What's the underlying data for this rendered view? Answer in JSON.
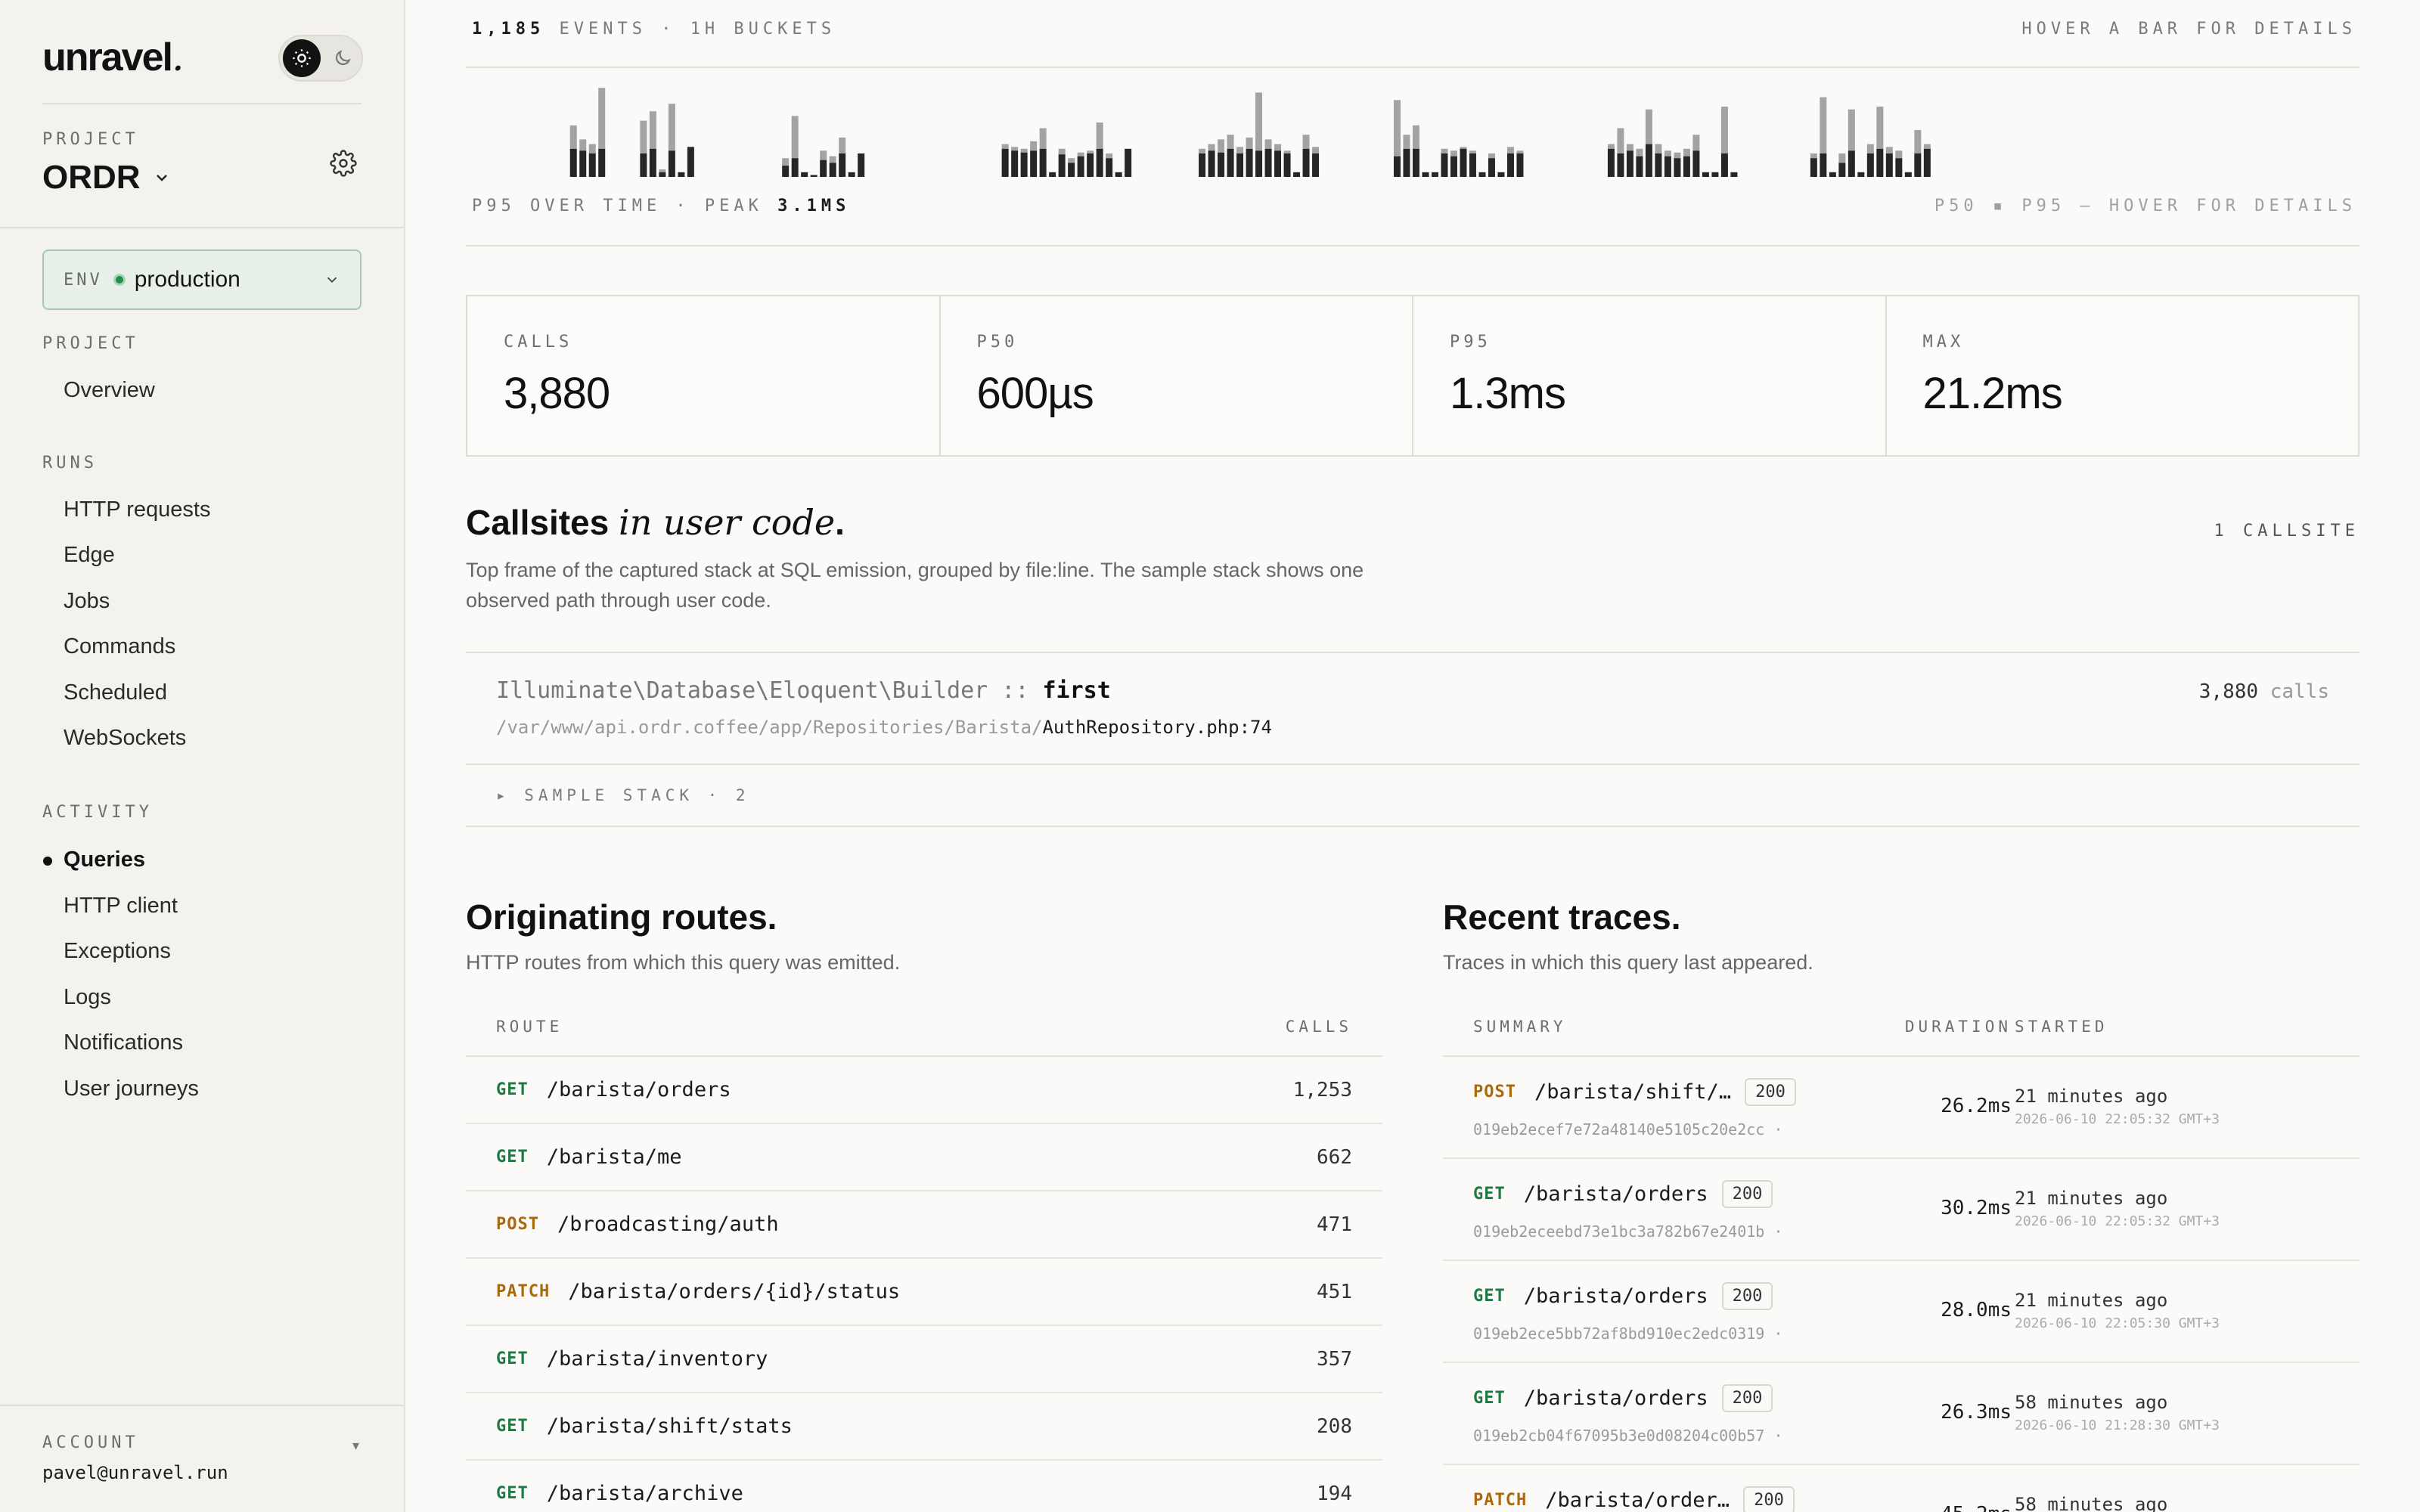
{
  "sidebar": {
    "brand": "unravel",
    "brand_suffix": ".",
    "project_label": "PROJECT",
    "project_name": "ORDR",
    "env_label": "ENV",
    "env_value": "production",
    "sections": [
      {
        "label": "PROJECT",
        "items": [
          "Overview"
        ]
      },
      {
        "label": "RUNS",
        "items": [
          "HTTP requests",
          "Edge",
          "Jobs",
          "Commands",
          "Scheduled",
          "WebSockets"
        ]
      },
      {
        "label": "ACTIVITY",
        "items": [
          "Queries",
          "HTTP client",
          "Exceptions",
          "Logs",
          "Notifications",
          "User journeys"
        ]
      }
    ],
    "active_item": "Queries",
    "account_label": "ACCOUNT",
    "account_email": "pavel@unravel.run",
    "account_toggle": "▾"
  },
  "chart": {
    "events_count": "1,185",
    "events_rest": "EVENTS · 1H BUCKETS",
    "hover_hint": "HOVER A BAR FOR DETAILS",
    "p95_prefix": "P95 OVER TIME · PEAK",
    "peak": "3.1MS",
    "legend_right": "P50 ▪ P95 — HOVER FOR DETAILS",
    "colors": {
      "p50": "#262626",
      "p95": "#a3a3a3"
    }
  },
  "chart_data": {
    "type": "bar",
    "series": [
      {
        "name": "P50",
        "color": "#262626"
      },
      {
        "name": "P95",
        "color": "#a3a3a3"
      }
    ],
    "groups": [
      {
        "start": 0.055,
        "bars": [
          [
            0.3,
            0.55
          ],
          [
            0.28,
            0.4
          ],
          [
            0.25,
            0.35
          ],
          [
            0.3,
            0.95
          ]
        ]
      },
      {
        "start": 0.092,
        "bars": [
          [
            0.25,
            0.6
          ],
          [
            0.3,
            0.7
          ],
          [
            0.05,
            0.08
          ],
          [
            0.28,
            0.78
          ],
          [
            0.05,
            0.05
          ],
          [
            0.32,
            0.32
          ]
        ]
      },
      {
        "start": 0.167,
        "bars": [
          [
            0.12,
            0.2
          ],
          [
            0.2,
            0.65
          ],
          [
            0.05,
            0.05
          ],
          [
            0.02,
            0.02
          ],
          [
            0.18,
            0.28
          ],
          [
            0.15,
            0.22
          ],
          [
            0.25,
            0.42
          ],
          [
            0.05,
            0.05
          ],
          [
            0.25,
            0.25
          ]
        ]
      },
      {
        "start": 0.283,
        "bars": [
          [
            0.3,
            0.35
          ],
          [
            0.28,
            0.32
          ],
          [
            0.26,
            0.3
          ],
          [
            0.28,
            0.38
          ],
          [
            0.3,
            0.52
          ],
          [
            0.05,
            0.05
          ],
          [
            0.24,
            0.3
          ],
          [
            0.15,
            0.2
          ],
          [
            0.22,
            0.26
          ],
          [
            0.25,
            0.28
          ],
          [
            0.3,
            0.58
          ],
          [
            0.2,
            0.25
          ],
          [
            0.05,
            0.05
          ],
          [
            0.3,
            0.3
          ]
        ]
      },
      {
        "start": 0.387,
        "bars": [
          [
            0.25,
            0.3
          ],
          [
            0.28,
            0.35
          ],
          [
            0.26,
            0.4
          ],
          [
            0.3,
            0.45
          ],
          [
            0.25,
            0.32
          ],
          [
            0.3,
            0.42
          ],
          [
            0.28,
            0.9
          ],
          [
            0.3,
            0.4
          ],
          [
            0.28,
            0.35
          ],
          [
            0.25,
            0.28
          ],
          [
            0.05,
            0.05
          ],
          [
            0.3,
            0.45
          ],
          [
            0.25,
            0.32
          ]
        ]
      },
      {
        "start": 0.49,
        "bars": [
          [
            0.22,
            0.82
          ],
          [
            0.3,
            0.45
          ],
          [
            0.3,
            0.55
          ],
          [
            0.05,
            0.05
          ],
          [
            0.05,
            0.05
          ],
          [
            0.25,
            0.3
          ],
          [
            0.22,
            0.28
          ],
          [
            0.3,
            0.32
          ],
          [
            0.25,
            0.28
          ],
          [
            0.05,
            0.05
          ],
          [
            0.2,
            0.25
          ],
          [
            0.05,
            0.05
          ],
          [
            0.25,
            0.32
          ],
          [
            0.25,
            0.28
          ]
        ]
      },
      {
        "start": 0.603,
        "bars": [
          [
            0.3,
            0.35
          ],
          [
            0.25,
            0.52
          ],
          [
            0.28,
            0.35
          ],
          [
            0.22,
            0.3
          ],
          [
            0.35,
            0.72
          ],
          [
            0.25,
            0.35
          ],
          [
            0.22,
            0.28
          ],
          [
            0.2,
            0.26
          ],
          [
            0.22,
            0.3
          ],
          [
            0.28,
            0.45
          ],
          [
            0.05,
            0.05
          ],
          [
            0.05,
            0.05
          ],
          [
            0.25,
            0.75
          ],
          [
            0.05,
            0.05
          ]
        ]
      },
      {
        "start": 0.71,
        "bars": [
          [
            0.2,
            0.25
          ],
          [
            0.25,
            0.85
          ],
          [
            0.05,
            0.05
          ],
          [
            0.15,
            0.25
          ],
          [
            0.28,
            0.72
          ],
          [
            0.05,
            0.05
          ],
          [
            0.25,
            0.35
          ],
          [
            0.3,
            0.75
          ],
          [
            0.25,
            0.32
          ],
          [
            0.2,
            0.28
          ],
          [
            0.05,
            0.05
          ],
          [
            0.25,
            0.5
          ],
          [
            0.3,
            0.35
          ]
        ]
      }
    ],
    "xlabel": "",
    "ylabel": ""
  },
  "stats": [
    {
      "label": "CALLS",
      "value": "3,880"
    },
    {
      "label": "P50",
      "value": "600µs"
    },
    {
      "label": "P95",
      "value": "1.3ms"
    },
    {
      "label": "MAX",
      "value": "21.2ms"
    }
  ],
  "callsites": {
    "title": "Callsites",
    "title_em": "in user code",
    "title_dot": ".",
    "count": "1 CALLSITE",
    "description": "Top frame of the captured stack at SQL emission, grouped by file:line. The sample stack shows one observed path through user code.",
    "fn_class": "Illuminate\\Database\\Eloquent\\Builder",
    "fn_sep": "::",
    "fn_name": "first",
    "path_dir": "/var/www/api.ordr.coffee/app/Repositories/Barista/",
    "path_file": "AuthRepository.php",
    "path_line": ":74",
    "calls_num": "3,880",
    "calls_unit": "calls",
    "sample_stack": "▸ SAMPLE STACK · 2"
  },
  "routes": {
    "title": "Originating routes.",
    "description": "HTTP routes from which this query was emitted.",
    "col_route": "ROUTE",
    "col_calls": "CALLS",
    "rows": [
      {
        "method": "GET",
        "path": "/barista/orders",
        "calls": "1,253"
      },
      {
        "method": "GET",
        "path": "/barista/me",
        "calls": "662"
      },
      {
        "method": "POST",
        "path": "/broadcasting/auth",
        "calls": "471"
      },
      {
        "method": "PATCH",
        "path": "/barista/orders/{id}/status",
        "calls": "451"
      },
      {
        "method": "GET",
        "path": "/barista/inventory",
        "calls": "357"
      },
      {
        "method": "GET",
        "path": "/barista/shift/stats",
        "calls": "208"
      },
      {
        "method": "GET",
        "path": "/barista/archive",
        "calls": "194"
      }
    ]
  },
  "traces": {
    "title": "Recent traces.",
    "description": "Traces in which this query last appeared.",
    "col_summary": "SUMMARY",
    "col_duration": "DURATION",
    "col_started": "STARTED",
    "rows": [
      {
        "method": "POST",
        "path": "/barista/shift/…",
        "status": "200",
        "id": "019eb2ecef7e72a48140e5105c20e2cc ·",
        "duration": "26.2ms",
        "ago": "21 minutes ago",
        "ts": "2026-06-10 22:05:32 GMT+3"
      },
      {
        "method": "GET",
        "path": "/barista/orders",
        "status": "200",
        "id": "019eb2eceebd73e1bc3a782b67e2401b ·",
        "duration": "30.2ms",
        "ago": "21 minutes ago",
        "ts": "2026-06-10 22:05:32 GMT+3"
      },
      {
        "method": "GET",
        "path": "/barista/orders",
        "status": "200",
        "id": "019eb2ece5bb72af8bd910ec2edc0319 ·",
        "duration": "28.0ms",
        "ago": "21 minutes ago",
        "ts": "2026-06-10 22:05:30 GMT+3"
      },
      {
        "method": "GET",
        "path": "/barista/orders",
        "status": "200",
        "id": "019eb2cb04f67095b3e0d08204c00b57 ·",
        "duration": "26.3ms",
        "ago": "58 minutes ago",
        "ts": "2026-06-10 21:28:30 GMT+3"
      },
      {
        "method": "PATCH",
        "path": "/barista/order…",
        "status": "200",
        "id": "",
        "duration": "45.2ms",
        "ago": "58 minutes ago",
        "ts": ""
      }
    ]
  }
}
